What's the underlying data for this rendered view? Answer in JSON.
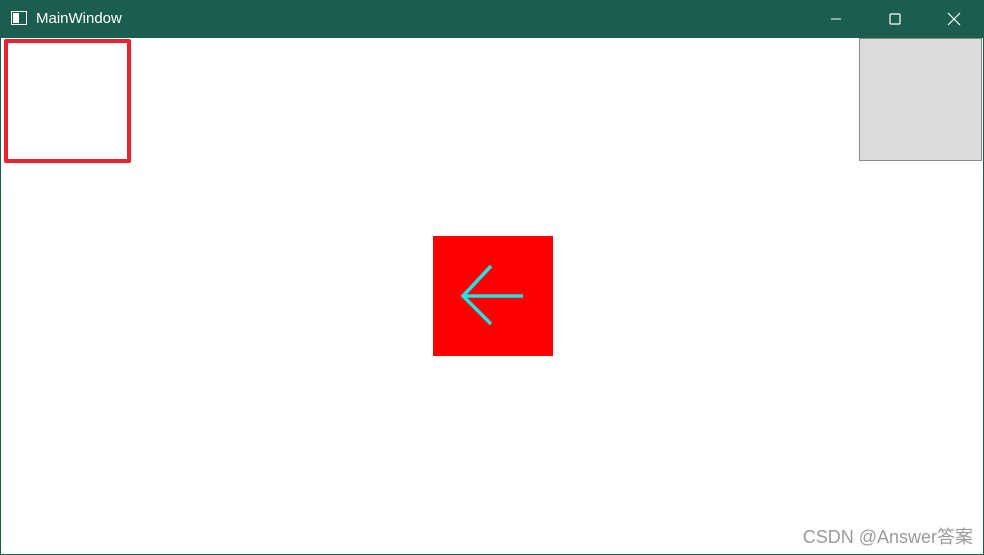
{
  "window": {
    "title": "MainWindow",
    "titlebar_color": "#1b5e4f",
    "controls": {
      "minimize_icon": "minimize-icon",
      "maximize_icon": "maximize-icon",
      "close_icon": "close-icon"
    }
  },
  "content": {
    "frame_color": "#e8222e",
    "gray_box_color": "#dcdcdc",
    "back_button": {
      "background": "#ff0000",
      "icon": "arrow-left-icon",
      "icon_color": "#22e4e4"
    }
  },
  "watermark": "CSDN @Answer答案"
}
